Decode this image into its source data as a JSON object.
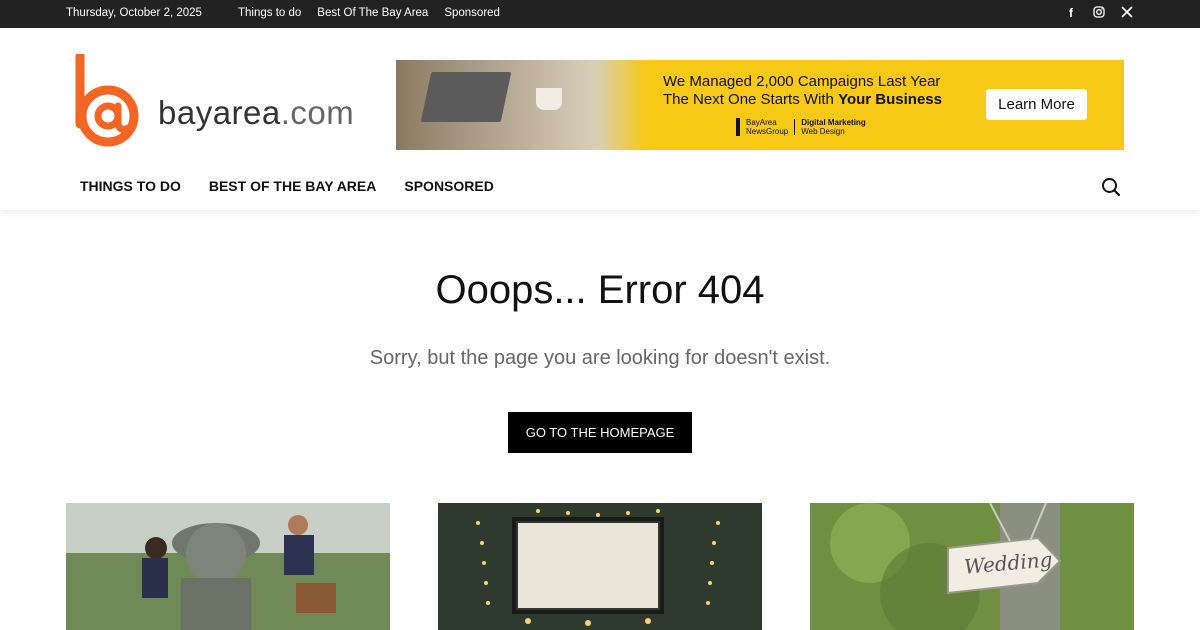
{
  "topbar": {
    "date": "Thursday, October 2, 2025",
    "links": [
      "Things to do",
      "Best Of The Bay Area",
      "Sponsored"
    ],
    "social": [
      "facebook-icon",
      "instagram-icon",
      "x-icon"
    ]
  },
  "logo": {
    "name": "bayarea",
    "domain": ".com",
    "accent": "#f26522"
  },
  "banner": {
    "line1": "We Managed 2,000 Campaigns Last Year",
    "line2_prefix": "The Next One Starts With ",
    "line2_bold": "Your Business",
    "brand_left_1": "BayArea",
    "brand_left_2": "NewsGroup",
    "brand_right_1": "Digital Marketing",
    "brand_right_2": "Web Design",
    "cta": "Learn More",
    "bg": "#f5c916"
  },
  "nav": {
    "items": [
      "THINGS TO DO",
      "BEST OF THE BAY AREA",
      "SPONSORED"
    ]
  },
  "error": {
    "title": "Ooops... Error 404",
    "subtitle": "Sorry, but the page you are looking for doesn't exist.",
    "button": "GO TO THE HOMEPAGE"
  },
  "cards": {
    "card3_sign": "Wedding"
  }
}
